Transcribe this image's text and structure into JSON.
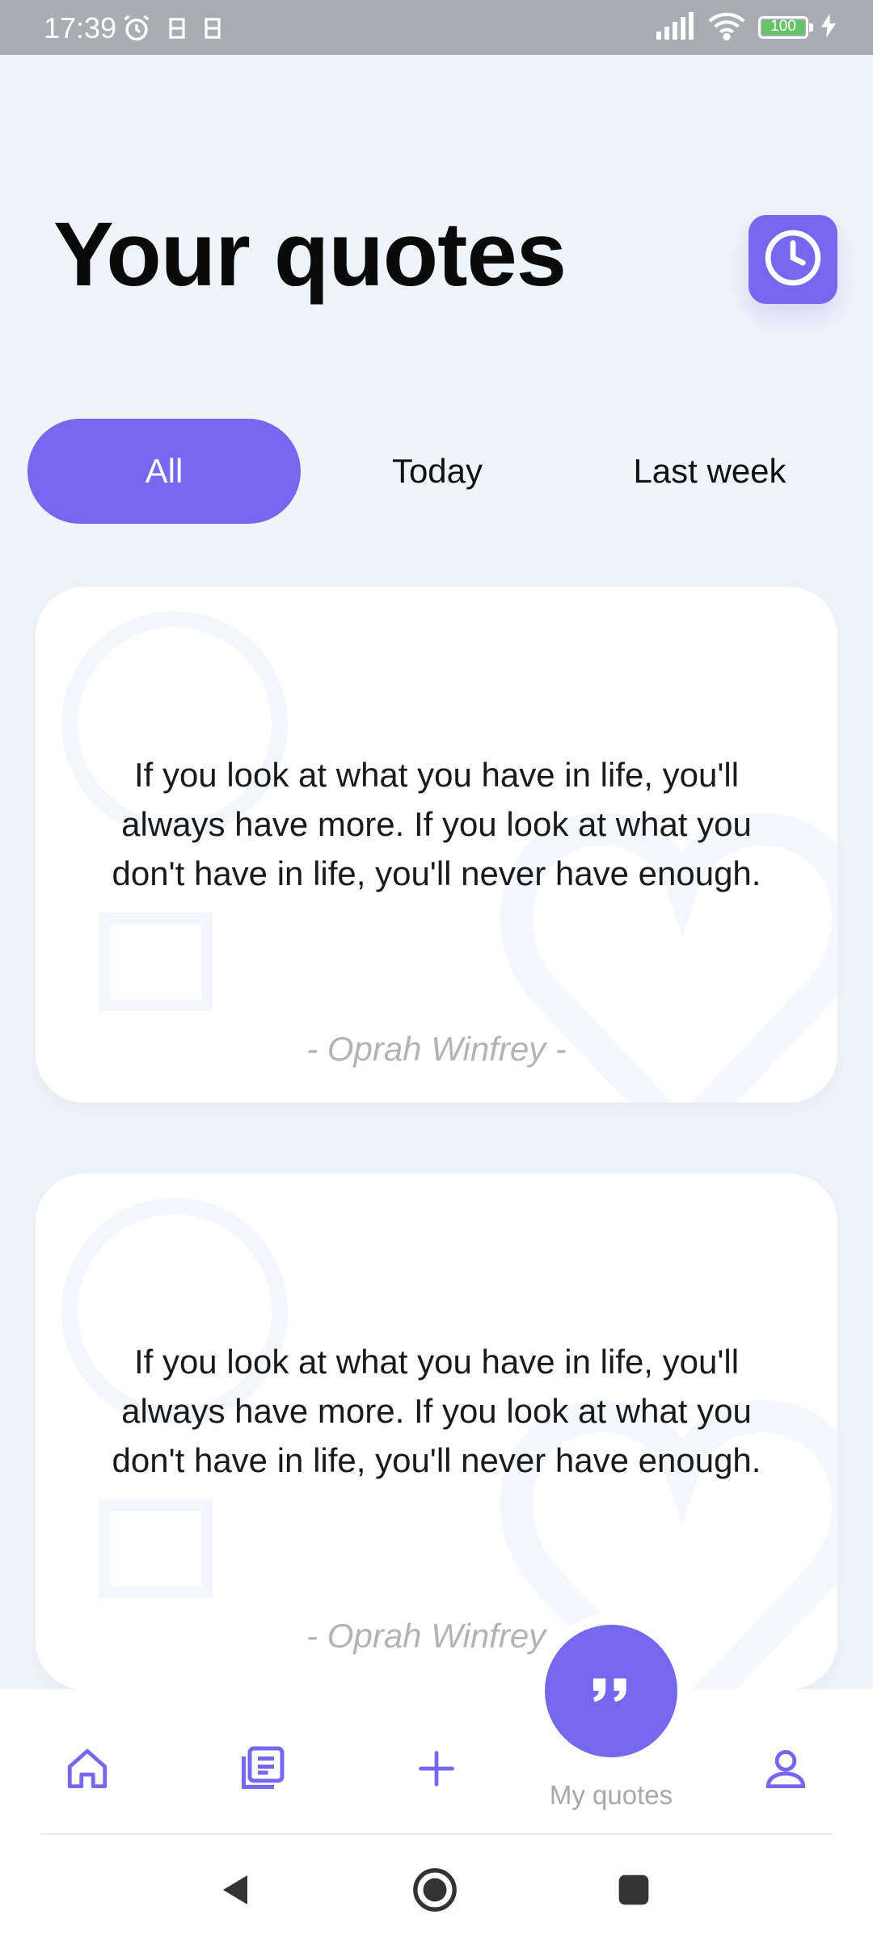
{
  "status_bar": {
    "time": "17:39",
    "battery": "100",
    "icons": [
      "alarm-icon",
      "notification-icon",
      "notification-icon",
      "signal-icon",
      "wifi-icon",
      "battery-icon",
      "charging-icon"
    ]
  },
  "header": {
    "title": "Your quotes",
    "history_icon": "clock-icon"
  },
  "filters": {
    "items": [
      {
        "label": "All",
        "active": true
      },
      {
        "label": "Today",
        "active": false
      },
      {
        "label": "Last week",
        "active": false
      }
    ]
  },
  "quotes": [
    {
      "text": "If you look at what you have in life, you'll always have more. If you look at what you don't have in life, you'll never have enough.",
      "author": "- Oprah Winfrey -"
    },
    {
      "text": "If you look at what you have in life, you'll always have more. If you look at what you don't have in life, you'll never have enough.",
      "author": "- Oprah Winfrey -"
    }
  ],
  "bottom_nav": {
    "items": [
      {
        "icon": "home-icon"
      },
      {
        "icon": "library-icon"
      },
      {
        "icon": "plus-icon"
      },
      {
        "icon": "quote-icon",
        "label": "My quotes",
        "active": true
      },
      {
        "icon": "profile-icon"
      }
    ]
  },
  "system_nav": [
    "back-icon",
    "home-circle-icon",
    "recents-icon"
  ],
  "colors": {
    "accent": "#7567ee",
    "background": "#eff4f9",
    "card": "#ffffff",
    "muted_text": "#b3b3b3"
  }
}
